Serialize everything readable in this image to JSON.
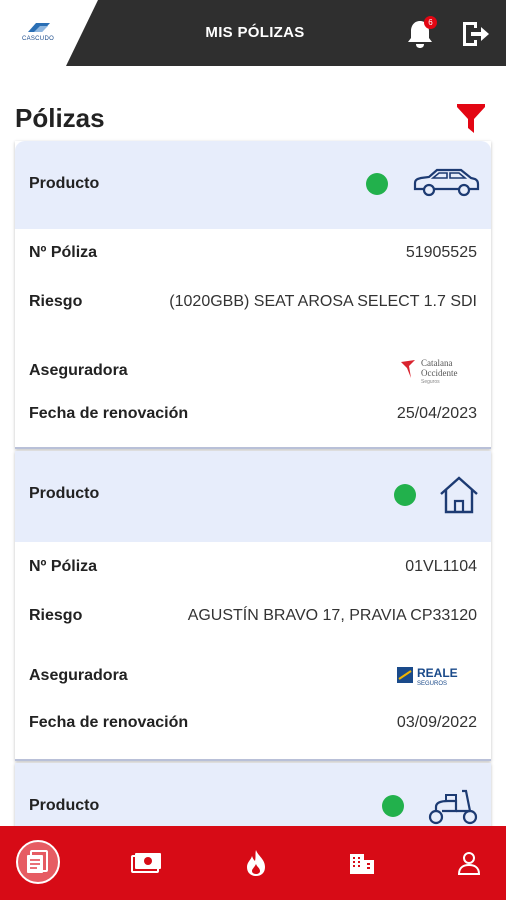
{
  "header": {
    "logo_text": "CASCUDO",
    "title": "MIS PÓLIZAS",
    "notification_count": "6",
    "accent": "#e30613",
    "dark": "#2f2f2f"
  },
  "page": {
    "title": "Pólizas"
  },
  "labels": {
    "producto": "Producto",
    "poliza": "Nº Póliza",
    "riesgo": "Riesgo",
    "aseguradora": "Aseguradora",
    "fecha": "Fecha de renovación"
  },
  "policies": [
    {
      "product_icon": "car-icon",
      "status_color": "#22b14c",
      "policy_number": "51905525",
      "risk": "(1020GBB) SEAT AROSA SELECT 1.7 SDI",
      "insurer_logo_text": [
        "Catalana",
        "Occidente",
        "Seguros"
      ],
      "renewal_date": "25/04/2023"
    },
    {
      "product_icon": "house-icon",
      "status_color": "#22b14c",
      "policy_number": "01VL1104",
      "risk": "AGUSTÍN BRAVO 17, PRAVIA CP33120",
      "insurer_logo_text": [
        "REALE",
        "SEGUROS"
      ],
      "renewal_date": "03/09/2022"
    },
    {
      "product_icon": "scooter-icon",
      "status_color": "#22b14c"
    }
  ],
  "bottom_nav": {
    "background": "#d70b16",
    "items": [
      "policies-icon",
      "payments-icon",
      "claims-flame-icon",
      "buildings-icon",
      "profile-icon"
    ]
  }
}
